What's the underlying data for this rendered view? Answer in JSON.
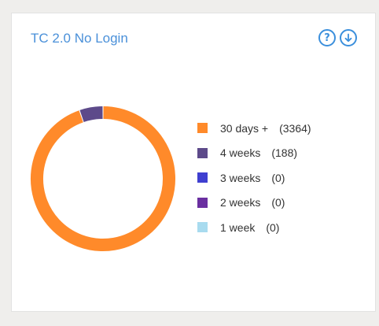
{
  "card": {
    "title": "TC 2.0 No Login"
  },
  "icons": {
    "help": "help-circle-icon",
    "download": "download-circle-icon",
    "accent": "#3b8fdc"
  },
  "chart_data": {
    "type": "pie",
    "variant": "donut",
    "title": "TC 2.0 No Login",
    "legend_position": "right",
    "series": [
      {
        "label": "30 days +",
        "value": 3364,
        "count_text": "(3364)",
        "color": "#ff8a2a"
      },
      {
        "label": "4 weeks",
        "value": 188,
        "count_text": "(188)",
        "color": "#5d4a8a"
      },
      {
        "label": "3 weeks",
        "value": 0,
        "count_text": "(0)",
        "color": "#3f3fd0"
      },
      {
        "label": "2 weeks",
        "value": 0,
        "count_text": "(0)",
        "color": "#6a2fa0"
      },
      {
        "label": "1 week",
        "value": 0,
        "count_text": "(0)",
        "color": "#a8dbef"
      }
    ]
  }
}
